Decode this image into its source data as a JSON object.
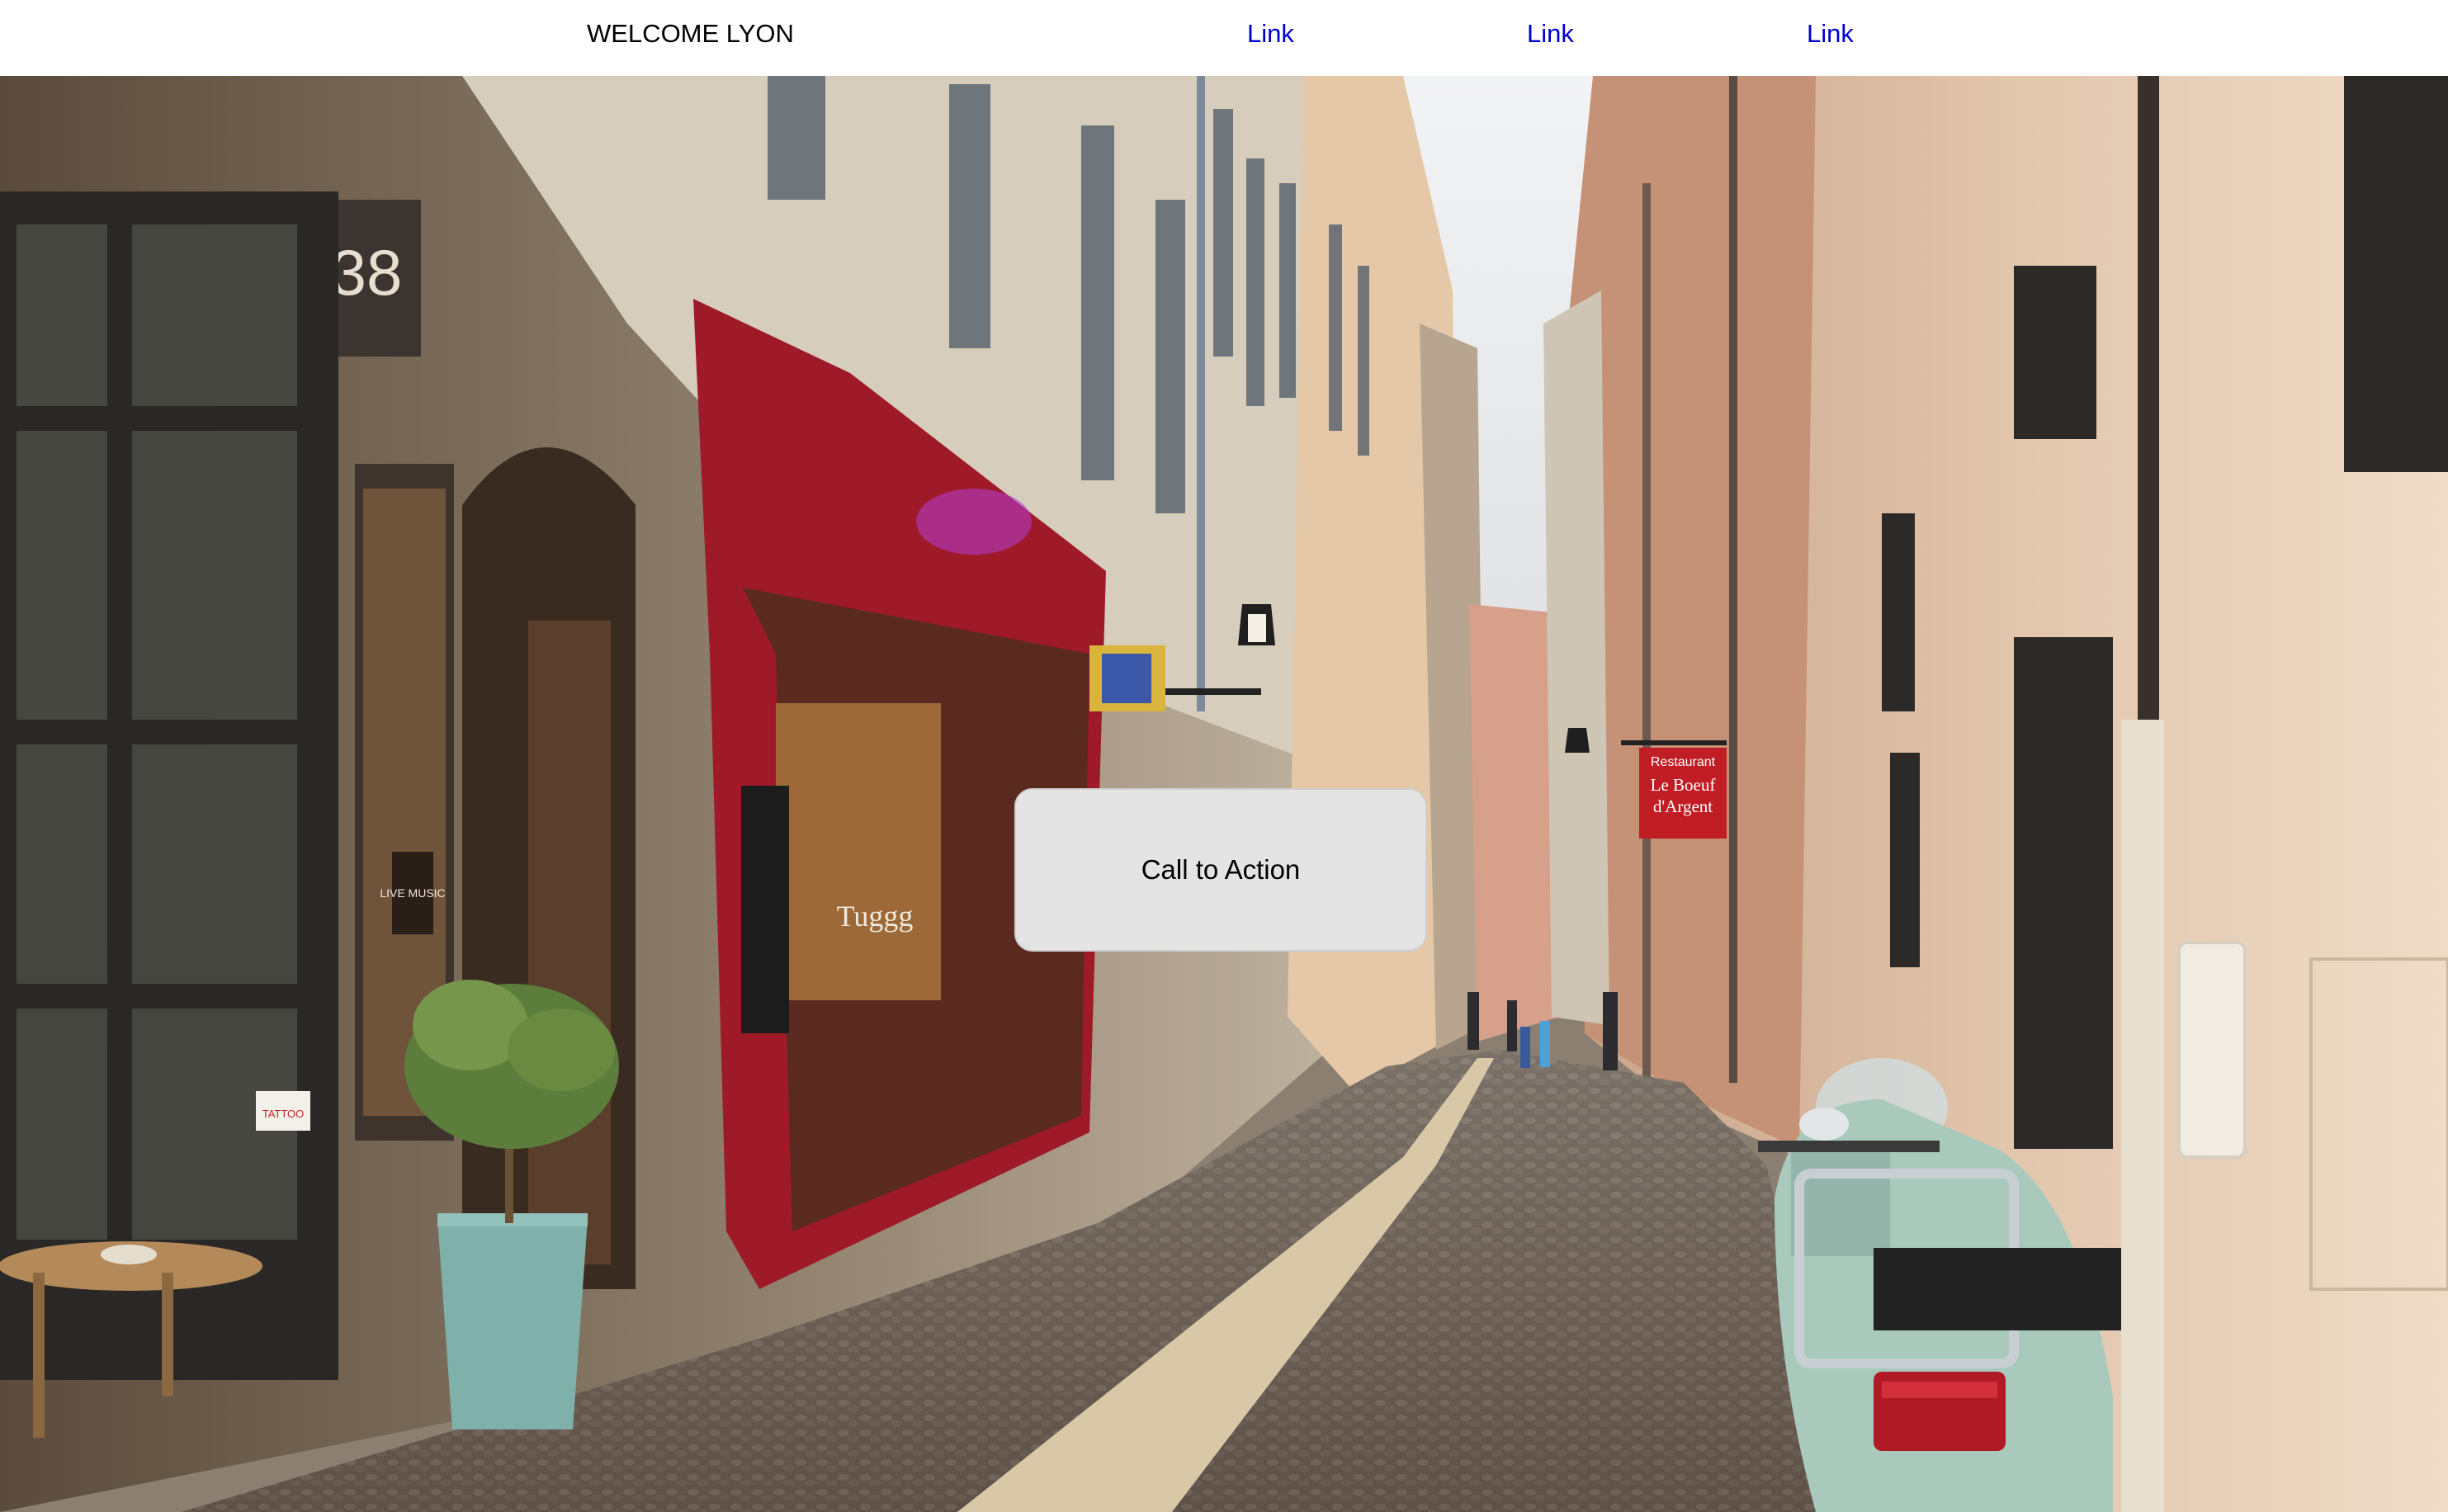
{
  "header": {
    "brand": "WELCOME LYON",
    "links": [
      {
        "label": "Link"
      },
      {
        "label": "Link"
      },
      {
        "label": "Link"
      }
    ]
  },
  "hero": {
    "cta_label": "Call to Action",
    "photo": {
      "house_number": "38",
      "restaurant_sign_top": "Restaurant",
      "restaurant_sign_name_1": "Le Boeuf",
      "restaurant_sign_name_2": "d'Argent",
      "poster_music": "LIVE MUSIC",
      "sticker_tattoo": "TATTOO",
      "shop_sign": "Tuggg"
    }
  },
  "colors": {
    "link": "#0000cc",
    "cta_background": "#e4e4e4",
    "storefront_red": "#9e1a28",
    "restaurant_sign": "#c01e24",
    "scooter_green": "#a9c9bd",
    "pot_teal": "#7fb0aa"
  }
}
